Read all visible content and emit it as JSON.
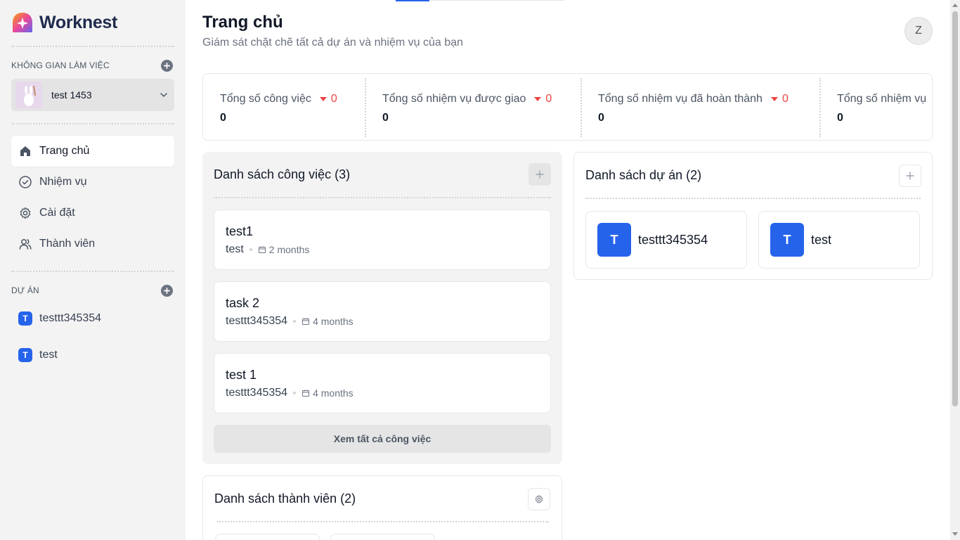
{
  "app": {
    "name": "Worknest"
  },
  "sidebar": {
    "workspace_label": "KHÔNG GIAN LÀM VIỆC",
    "workspace_name": "test 1453",
    "nav": [
      {
        "label": "Trang chủ",
        "icon": "home-icon",
        "active": true
      },
      {
        "label": "Nhiệm vụ",
        "icon": "check-circle-icon"
      },
      {
        "label": "Cài đặt",
        "icon": "gear-icon"
      },
      {
        "label": "Thành viên",
        "icon": "users-icon"
      }
    ],
    "projects_label": "DỰ ÁN",
    "projects": [
      {
        "badge": "T",
        "name": "testtt345354"
      },
      {
        "badge": "T",
        "name": "test"
      }
    ]
  },
  "header": {
    "title": "Trang chủ",
    "subtitle": "Giám sát chặt chẽ tất cả dự án và nhiệm vụ của bạn",
    "user_initial": "Z"
  },
  "stats": [
    {
      "label": "Tổng số công việc",
      "delta": "0",
      "value": "0"
    },
    {
      "label": "Tổng số nhiệm vụ được giao",
      "delta": "0",
      "value": "0"
    },
    {
      "label": "Tổng số nhiệm vụ đã hoàn thành",
      "delta": "0",
      "value": "0"
    },
    {
      "label": "Tổng số nhiệm vụ",
      "value": "0"
    }
  ],
  "tasks_card": {
    "title": "Danh sách công việc (3)",
    "items": [
      {
        "name": "test1",
        "project": "test",
        "time": "2 months"
      },
      {
        "name": "task 2",
        "project": "testtt345354",
        "time": "4 months"
      },
      {
        "name": "test 1",
        "project": "testtt345354",
        "time": "4 months"
      }
    ],
    "view_all": "Xem tất cả công việc"
  },
  "projects_card": {
    "title": "Danh sách dự án (2)",
    "items": [
      {
        "badge": "T",
        "name": "testtt345354"
      },
      {
        "badge": "T",
        "name": "test"
      }
    ]
  },
  "members_card": {
    "title": "Danh sách thành viên (2)"
  },
  "colors": {
    "accent": "#2563eb",
    "delta_negative": "#ef4444",
    "sidebar_bg": "#f3f3f3"
  }
}
